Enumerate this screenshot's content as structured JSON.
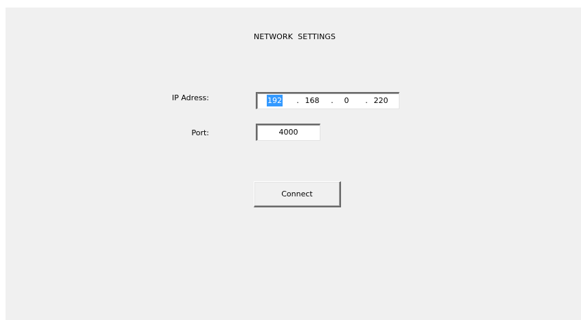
{
  "window": {
    "title": "NETWORK  SETTINGS"
  },
  "form": {
    "ip_label": "IP Adress:",
    "ip_octets": [
      "192",
      "168",
      "0",
      "220"
    ],
    "ip_separator": ".",
    "port_label": "Port:",
    "port_value": "4000",
    "connect_label": "Connect"
  },
  "colors": {
    "panel_background": "#f0f0f0",
    "selection_highlight": "#3399ff"
  }
}
